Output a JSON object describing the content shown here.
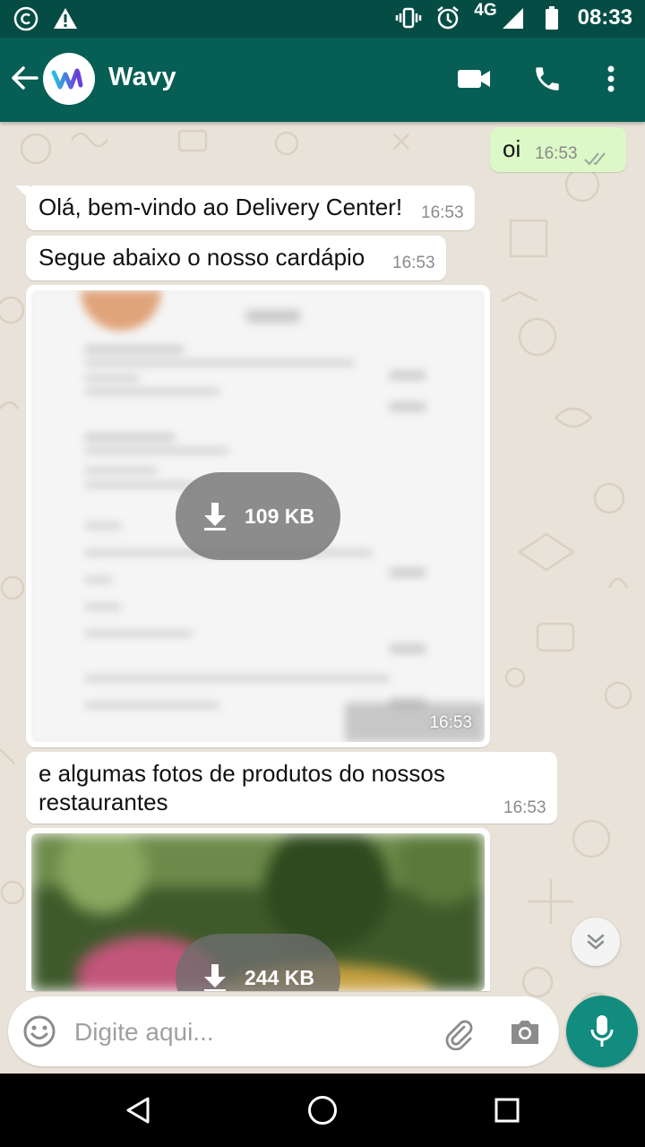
{
  "status_bar": {
    "network": "4G",
    "time": "08:33"
  },
  "header": {
    "contact_name": "Wavy"
  },
  "messages": [
    {
      "direction": "out",
      "text": "oi",
      "time": "16:53"
    },
    {
      "direction": "in",
      "text": "Olá, bem-vindo ao Delivery Center!",
      "time": "16:53"
    },
    {
      "direction": "in",
      "text": "Segue abaixo o nosso cardápio",
      "time": "16:53"
    },
    {
      "direction": "in",
      "type": "image",
      "download_size": "109 KB",
      "time": "16:53"
    },
    {
      "direction": "in",
      "text_line1": "e algumas fotos de produtos do nossos",
      "text_line2": "restaurantes",
      "time": "16:53"
    },
    {
      "direction": "in",
      "type": "image",
      "download_size": "244 KB"
    }
  ],
  "composer": {
    "placeholder": "Digite aqui..."
  },
  "colors": {
    "header": "#075e54",
    "status_bar": "#054d44",
    "outgoing_bubble": "#dcf8c6",
    "fab": "#128c7e"
  }
}
